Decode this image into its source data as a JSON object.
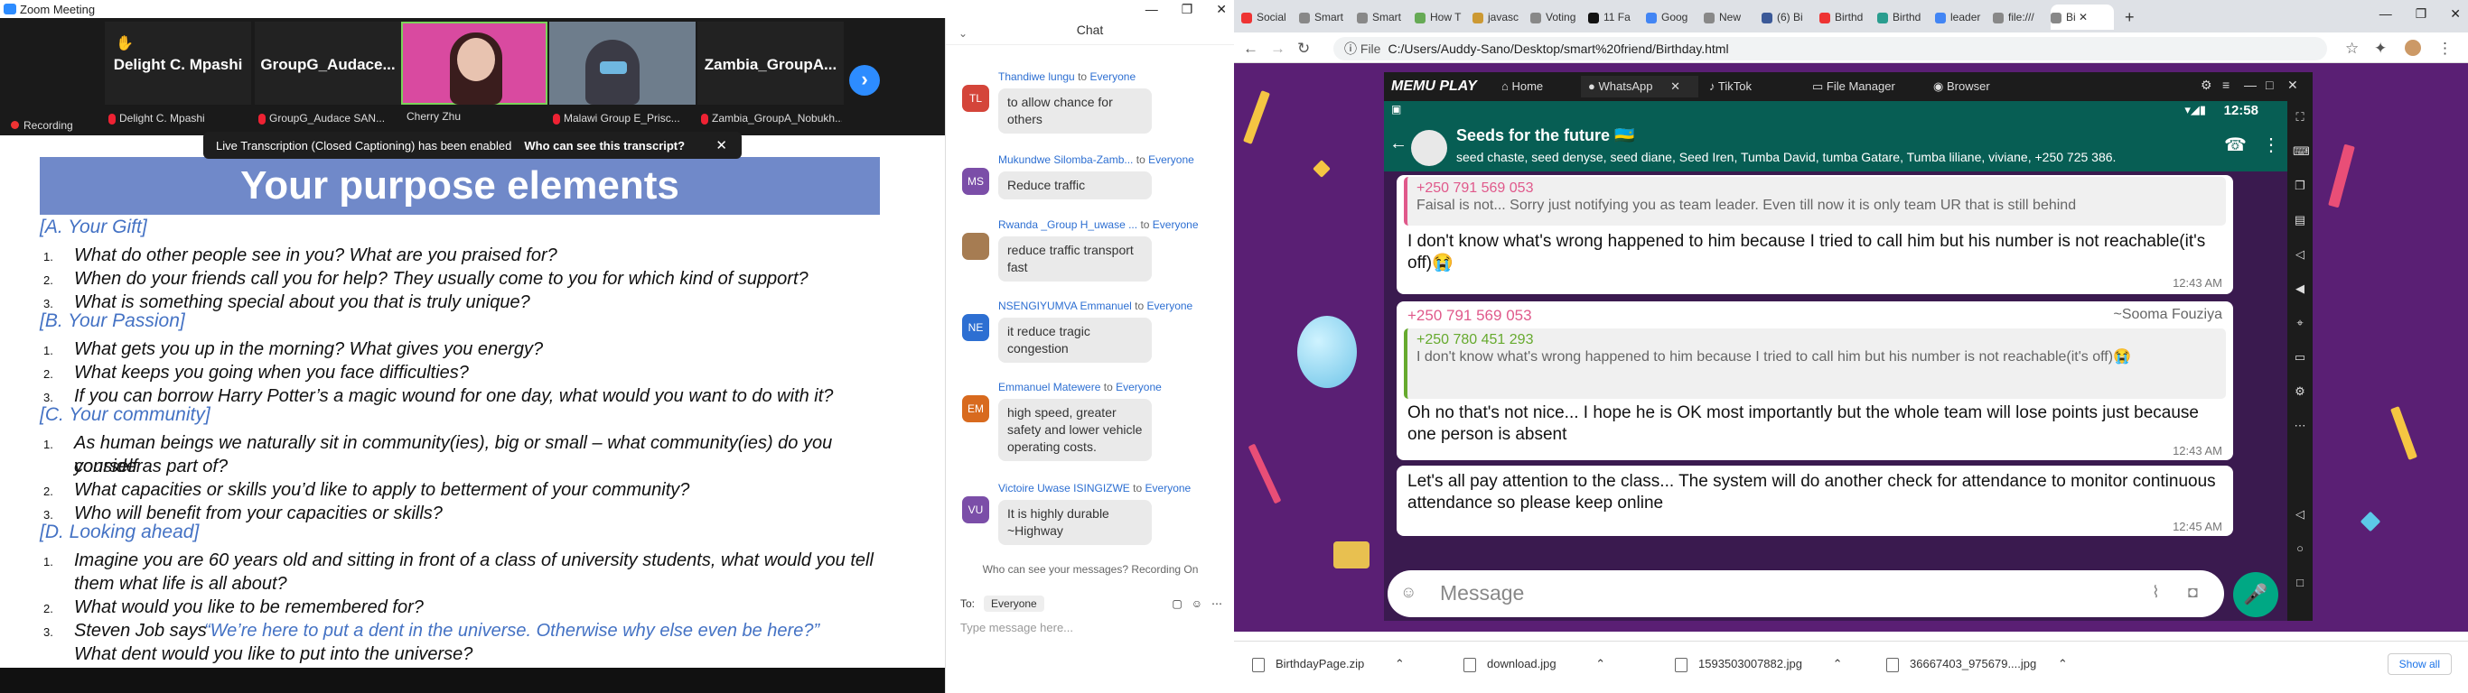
{
  "zoom": {
    "window_title": "Zoom Meeting",
    "recording_label": "Recording",
    "participants": [
      {
        "name": "Delight C. Mpashi",
        "sub": "Delight C. Mpashi"
      },
      {
        "name": "GroupG_Audace...",
        "sub": "GroupG_Audace SAN..."
      },
      {
        "name": "",
        "sub": "Cherry Zhu"
      },
      {
        "name": "",
        "sub": "Malawi Group E_Prisc..."
      },
      {
        "name": "Zambia_GroupA...",
        "sub": "Zambia_GroupA_Nobukh..."
      }
    ],
    "transcript_notice": "Live Transcription (Closed Captioning) has been enabled",
    "transcript_link": "Who can see this transcript?",
    "slide": {
      "title": "Your purpose elements",
      "sections": [
        {
          "heading": "[A. Your Gift]",
          "questions": [
            "What do other people see in you? What are you praised for?",
            "When do your friends call you for help? They usually come to you for which kind of support?",
            "What is something special about you that is truly unique?"
          ]
        },
        {
          "heading": "[B. Your Passion]",
          "questions": [
            "What gets you up in the morning? What gives you energy?",
            "What keeps you going when you face difficulties?",
            "If you can borrow Harry Potter’s a magic wound for one day, what would you want to do with it?"
          ]
        },
        {
          "heading": "[C. Your community]",
          "questions": [
            "As human beings we naturally sit in community(ies), big or small – what community(ies) do you consider",
            "yourself as part of?",
            "What capacities or skills you’d like to apply to betterment of your community?",
            "Who will benefit from your capacities or skills?"
          ]
        },
        {
          "heading": "[D. Looking ahead]",
          "questions": [
            "Imagine you are 60 years old and sitting in front of a class of university students, what would you tell",
            "them what life is all about?",
            "What would you like to be remembered for?",
            "Steven Job says",
            "“We’re here to put a dent in the universe. Otherwise why else even be here?”",
            "What dent would you like to put into the universe?"
          ]
        }
      ]
    },
    "chat": {
      "title": "Chat",
      "to_label": "to",
      "messages": [
        {
          "sender": "Thandiwe lungu",
          "to": "Everyone",
          "initials": "TL",
          "color": "#d4453a",
          "text": "to allow chance for others"
        },
        {
          "sender": "Mukundwe Silomba-Zamb...",
          "to": "Everyone",
          "initials": "MS",
          "color": "#7b4ea8",
          "text": "Reduce traffic"
        },
        {
          "sender": "Rwanda _Group H_uwase ...",
          "to": "Everyone",
          "initials": "",
          "color": "#a67c52",
          "text": "reduce traffic transport fast"
        },
        {
          "sender": "NSENGIYUMVA Emmanuel",
          "to": "Everyone",
          "initials": "NE",
          "color": "#2d6fd2",
          "text": "it reduce tragic congestion"
        },
        {
          "sender": "Emmanuel Matewere",
          "to": "Everyone",
          "initials": "EM",
          "color": "#d86a1e",
          "text": "high speed, greater safety and lower vehicle operating costs."
        },
        {
          "sender": "Victoire Uwase ISINGIZWE",
          "to": "Everyone",
          "initials": "VU",
          "color": "#7b4ea8",
          "text": "It is highly durable ~Highway"
        }
      ],
      "who_can_see": "Who can see your messages? Recording On",
      "to": "To:",
      "recipient": "Everyone",
      "placeholder": "Type message here..."
    }
  },
  "browser": {
    "tabs": [
      "Social",
      "Smart",
      "Smart",
      "How T",
      "javasc",
      "Voting",
      "11 Fa",
      "Goog",
      "New",
      "(6) Bi",
      "Birthd",
      "Birthd",
      "leader",
      "file:///",
      "Bi"
    ],
    "file_label": "File",
    "url": "C:/Users/Auddy-Sano/Desktop/smart%20friend/Birthday.html",
    "memu": {
      "logo": "MEMU PLAY",
      "tabs": [
        "Home",
        "WhatsApp",
        "TikTok",
        "File Manager",
        "Browser"
      ],
      "time": "12:58",
      "group_name": "Seeds for the future 🇷🇼",
      "members": "seed chaste, seed denyse, seed diane, Seed Iren, Tumba David, tumba Gatare, Tumba liliane, viviane, +250 725 386...",
      "messages": [
        {
          "quote_sender": "+250 791 569 053",
          "quote_text": "Faisal is not... Sorry just notifying you as team leader. Even till now it is only team UR that is still behind",
          "text": "I don't know what's wrong happened to him because I tried to call him but his number is not reachable(it's off)😭",
          "time": "12:43 AM"
        },
        {
          "sender": "+250 791 569 053",
          "sender_name": "~Sooma Fouziya",
          "quote_sender": "+250 780 451 293",
          "quote_text": "I don't know what's wrong happened to him because I tried to call him but his number is not reachable(it's off)😭",
          "text": "Oh no that's not nice... I hope he is OK most importantly but the whole team will lose points just because one person is absent",
          "time": "12:43 AM"
        },
        {
          "text": "Let's all pay attention to the class... The system will do another check for attendance to monitor continuous attendance so please keep online",
          "time": "12:45 AM"
        }
      ],
      "input_placeholder": "Message"
    },
    "downloads": [
      "BirthdayPage.zip",
      "download.jpg",
      "1593503007882.jpg",
      "36667403_975679....jpg"
    ],
    "show_all": "Show all"
  }
}
